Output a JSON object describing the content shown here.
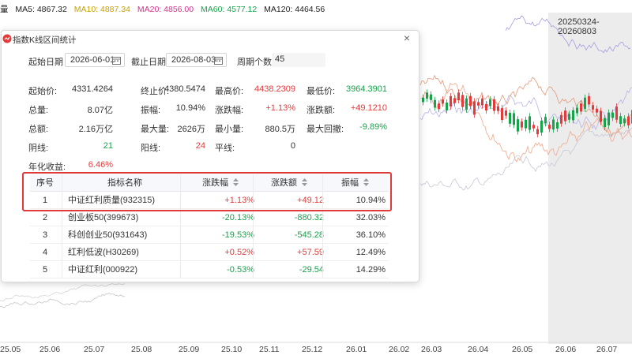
{
  "chart": {
    "ma_legend": [
      {
        "label": "MA5: 4867.32",
        "color": "#222222"
      },
      {
        "label": "MA10: 4887.34",
        "color": "#c9a000"
      },
      {
        "label": "MA20: 4856.00",
        "color": "#d6338a"
      },
      {
        "label": "MA60: 4577.12",
        "color": "#16a34a"
      },
      {
        "label": "MA120: 4464.56",
        "color": "#222222"
      }
    ],
    "legend_prefix": "量",
    "range_label": "20250324-20260803",
    "x_ticks": [
      "25.05",
      "25.06",
      "25.07",
      "25.08",
      "25.09",
      "25.10",
      "25.11",
      "25.12",
      "26.01",
      "26.02",
      "26.03",
      "26.04",
      "26.05",
      "26.06",
      "26.07"
    ]
  },
  "dialog": {
    "title": "指数K线区间统计",
    "close": "×",
    "start_label": "起始日期",
    "start_value": "2026-06-01",
    "end_label": "截止日期",
    "end_value": "2026-08-03",
    "period_label": "周期个数:",
    "period_value": "45",
    "stats": {
      "open_label": "起始价:",
      "open_value": "4331.4264",
      "close_label": "终止价:",
      "close_value": "4380.5474",
      "high_label": "最高价:",
      "high_value": "4438.2309",
      "low_label": "最低价:",
      "low_value": "3964.3901",
      "vol_label": "总量:",
      "vol_value": "8.07亿",
      "amp_label": "振幅:",
      "amp_value": "10.94%",
      "chg_pct_label": "涨跌幅:",
      "chg_pct_value": "+1.13%",
      "chg_label": "涨跌额:",
      "chg_value": "+49.1210",
      "amt_label": "总额:",
      "amt_value": "2.16万亿",
      "maxvol_label": "最大量:",
      "maxvol_value": "2626万",
      "minvol_label": "最小量:",
      "minvol_value": "880.5万",
      "maxdd_label": "最大回撤:",
      "maxdd_value": "-9.89%",
      "down_label": "阴线:",
      "down_value": "21",
      "up_label": "阳线:",
      "up_value": "24",
      "flat_label": "平线:",
      "flat_value": "0",
      "annual_label": "年化收益:",
      "annual_value": "6.46%"
    },
    "table": {
      "headers": {
        "no": "序号",
        "name": "指标名称",
        "chg_pct": "涨跌幅",
        "chg": "涨跌额",
        "amp": "振幅"
      },
      "rows": [
        {
          "no": "1",
          "name": "中证红利质量(932315)",
          "chg_pct": "+1.13%",
          "chg": "+49.12",
          "amp": "10.94%",
          "dir": "up"
        },
        {
          "no": "2",
          "name": "创业板50(399673)",
          "chg_pct": "-20.13%",
          "chg": "-880.32",
          "amp": "32.03%",
          "dir": "down"
        },
        {
          "no": "3",
          "name": "科创创业50(931643)",
          "chg_pct": "-19.53%",
          "chg": "-545.28",
          "amp": "36.10%",
          "dir": "down"
        },
        {
          "no": "4",
          "name": "红利低波(H30269)",
          "chg_pct": "+0.52%",
          "chg": "+57.59",
          "amp": "12.49%",
          "dir": "up"
        },
        {
          "no": "5",
          "name": "中证红利(000922)",
          "chg_pct": "-0.53%",
          "chg": "-29.54",
          "amp": "14.29%",
          "dir": "down"
        }
      ]
    }
  },
  "colors": {
    "up": "#e53a3a",
    "down": "#16a34a",
    "highlight": "#e03a3a"
  }
}
